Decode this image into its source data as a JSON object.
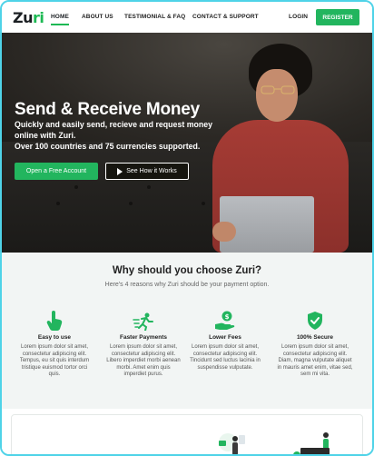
{
  "brand": {
    "logo_main": "Zu",
    "logo_accent": "ri",
    "accent_color": "#22b55e"
  },
  "nav": {
    "links": [
      "HOME",
      "ABOUT US",
      "TESTIMONIAL & FAQ",
      "CONTACT & SUPPORT"
    ],
    "login": "LOGIN",
    "register": "REGISTER"
  },
  "hero": {
    "title": "Send & Receive Money",
    "subtitle": "Quickly and easily send, recieve and request money online with Zuri.",
    "subtitle2": "Over 100 countries and 75 currencies supported.",
    "primary_cta": "Open a Free Account",
    "secondary_cta": "See How it Works"
  },
  "why": {
    "title": "Why should you choose Zuri?",
    "subtitle": "Here's 4 reasons why Zuri should be your payment option.",
    "features": [
      {
        "icon": "hand-pointer-icon",
        "title": "Easy to use",
        "desc": "Lorem ipsum dolor sit amet, consectetur adipiscing elit. Tempus, eu sit quis interdum tristique euismod tortor orci quis."
      },
      {
        "icon": "running-person-icon",
        "title": "Faster Payments",
        "desc": "Lorem ipsum dolor sit amet, consectetur adipiscing elit. Libero imperdiet morbi aenean morbi. Amet enim quis imperdiet purus."
      },
      {
        "icon": "hand-coin-icon",
        "title": "Lower Fees",
        "desc": "Lorem ipsum dolor sit amet, consectetur adipiscing elit. Tincidunt sed luctus lacinia in suspendisse vulputate."
      },
      {
        "icon": "shield-check-icon",
        "title": "100% Secure",
        "desc": "Lorem ipsum dolor sit amet, consectetur adipiscing elit. Diam, magna vulputate aliquet in mauris amet enim, vitae sed, sem mi vita."
      }
    ]
  }
}
